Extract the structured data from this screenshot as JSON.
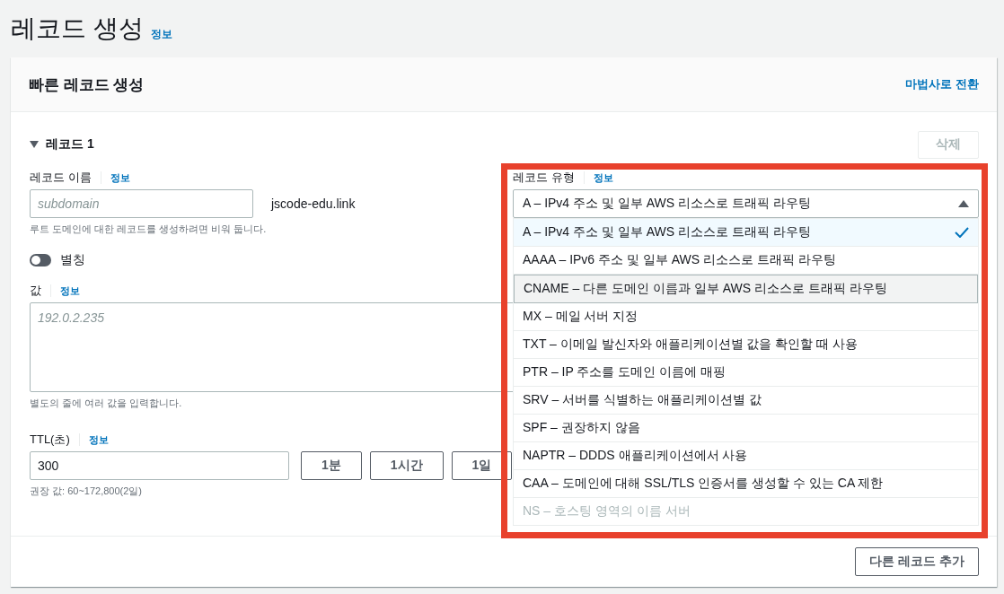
{
  "page": {
    "title": "레코드 생성",
    "info_link": "정보"
  },
  "card": {
    "title": "빠른 레코드 생성",
    "switch_link": "마법사로 전환"
  },
  "record": {
    "title": "레코드 1",
    "expanded": true,
    "delete_button": "삭제",
    "delete_disabled": true,
    "name": {
      "label": "레코드 이름",
      "info": "정보",
      "placeholder": "subdomain",
      "suffix": "jscode-edu.link",
      "hint": "루트 도메인에 대한 레코드를 생성하려면 비워 둡니다."
    },
    "alias": {
      "label": "별칭",
      "on": false
    },
    "value": {
      "label": "값",
      "info": "정보",
      "placeholder": "192.0.2.235",
      "hint": "별도의 줄에 여러 값을 입력합니다."
    },
    "ttl": {
      "label": "TTL(초)",
      "info": "정보",
      "value": "300",
      "presets": [
        "1분",
        "1시간",
        "1일"
      ],
      "hint": "권장 값: 60~172,800(2일)"
    },
    "type": {
      "label": "레코드 유형",
      "info": "정보",
      "value": "A – IPv4 주소 및 일부 AWS 리소스로 트래픽 라우팅",
      "expanded": true,
      "options": [
        {
          "label": "A – IPv4 주소 및 일부 AWS 리소스로 트래픽 라우팅",
          "selected": true,
          "highlighted": false,
          "disabled": false
        },
        {
          "label": "AAAA – IPv6 주소 및 일부 AWS 리소스로 트래픽 라우팅",
          "selected": false,
          "highlighted": false,
          "disabled": false
        },
        {
          "label": "CNAME – 다른 도메인 이름과 일부 AWS 리소스로 트래픽 라우팅",
          "selected": false,
          "highlighted": true,
          "disabled": false
        },
        {
          "label": "MX – 메일 서버 지정",
          "selected": false,
          "highlighted": false,
          "disabled": false
        },
        {
          "label": "TXT – 이메일 발신자와 애플리케이션별 값을 확인할 때 사용",
          "selected": false,
          "highlighted": false,
          "disabled": false
        },
        {
          "label": "PTR – IP 주소를 도메인 이름에 매핑",
          "selected": false,
          "highlighted": false,
          "disabled": false
        },
        {
          "label": "SRV – 서버를 식별하는 애플리케이션별 값",
          "selected": false,
          "highlighted": false,
          "disabled": false
        },
        {
          "label": "SPF – 권장하지 않음",
          "selected": false,
          "highlighted": false,
          "disabled": false
        },
        {
          "label": "NAPTR – DDDS 애플리케이션에서 사용",
          "selected": false,
          "highlighted": false,
          "disabled": false
        },
        {
          "label": "CAA – 도메인에 대해 SSL/TLS 인증서를 생성할 수 있는 CA 제한",
          "selected": false,
          "highlighted": false,
          "disabled": false
        },
        {
          "label": "NS – 호스팅 영역의 이름 서버",
          "selected": false,
          "highlighted": false,
          "disabled": true
        }
      ]
    }
  },
  "add_button": "다른 레코드 추가"
}
